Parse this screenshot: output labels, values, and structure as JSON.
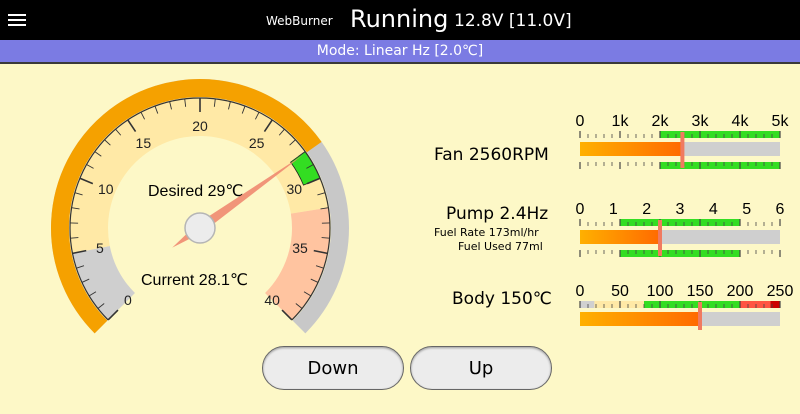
{
  "header": {
    "brand": "WebBurner",
    "state": "Running",
    "voltage": "12.8V [11.0V]"
  },
  "mode": {
    "text": "Mode: Linear Hz [2.0℃]"
  },
  "dial": {
    "scale_labels": [
      "0",
      "5",
      "10",
      "15",
      "20",
      "25",
      "30",
      "35",
      "40"
    ],
    "desired_label": "Desired 29℃",
    "current_label": "Current 28.1℃",
    "range": [
      0,
      40
    ],
    "desired": 29,
    "current": 28.1,
    "colors": {
      "arc_on": "#f5a100",
      "arc_off": "#c8c8c8",
      "band": "#ffe9a6",
      "green": "#33dd22",
      "hot": "#ffc4a0",
      "cold": "#cfcfcf",
      "needle": "#f08a70"
    }
  },
  "bars": [
    {
      "id": "fan",
      "name": "Fan 2560RPM",
      "tick_labels": [
        "0",
        "1k",
        "2k",
        "3k",
        "4k",
        "5k"
      ],
      "range": [
        0,
        5000
      ],
      "value": 2560,
      "green": [
        2000,
        5000
      ]
    },
    {
      "id": "pump",
      "name": "Pump 2.4Hz",
      "sub1": "Fuel Rate 173ml/hr",
      "sub2": "Fuel Used 77ml",
      "tick_labels": [
        "0",
        "1",
        "2",
        "3",
        "4",
        "5",
        "6"
      ],
      "range": [
        0,
        6
      ],
      "value": 2.4,
      "green": [
        1.2,
        4.8
      ]
    },
    {
      "id": "body",
      "name": "Body 150℃",
      "tick_labels": [
        "0",
        "50",
        "100",
        "150",
        "200",
        "250"
      ],
      "range": [
        0,
        250
      ],
      "value": 150,
      "zones": [
        [
          0,
          18,
          "#d0d0d0"
        ],
        [
          18,
          80,
          "#ffe9a6"
        ],
        [
          80,
          200,
          "#33dd22"
        ],
        [
          200,
          238,
          "#ff5544"
        ],
        [
          238,
          250,
          "#cc0000"
        ]
      ]
    }
  ],
  "buttons": {
    "down": "Down",
    "up": "Up"
  }
}
